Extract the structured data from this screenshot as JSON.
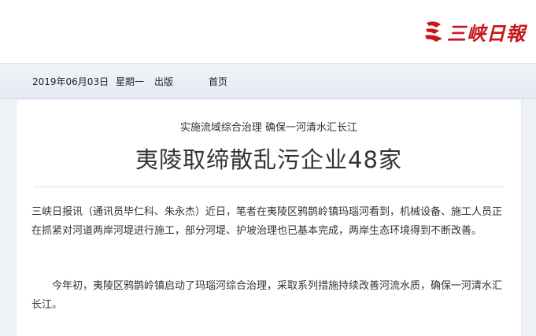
{
  "header": {
    "logo_text": "三峡日報"
  },
  "navbar": {
    "date": "2019年06月03日",
    "weekday": "星期一",
    "edition": "出版",
    "home": "首页"
  },
  "article": {
    "subtitle": "实施流域综合治理 确保一河清水汇长江",
    "title": "夷陵取缔散乱污企业48家",
    "paragraphs": [
      "三峡日报讯（通讯员毕仁科、朱永杰）近日，笔者在夷陵区鸦鹊岭镇玛瑙河看到，机械设备、施工人员正在抓紧对河道两岸河堤进行施工，部分河堤、护坡治理也已基本完成，两岸生态环境得到不断改善。",
      "今年初，夷陵区鸦鹊岭镇启动了玛瑙河综合治理，采取系列措施持续改善河流水质，确保一河清水汇长江。"
    ]
  },
  "colors": {
    "brand_red": "#c8161d",
    "nav_bg": "#e8eef5"
  }
}
